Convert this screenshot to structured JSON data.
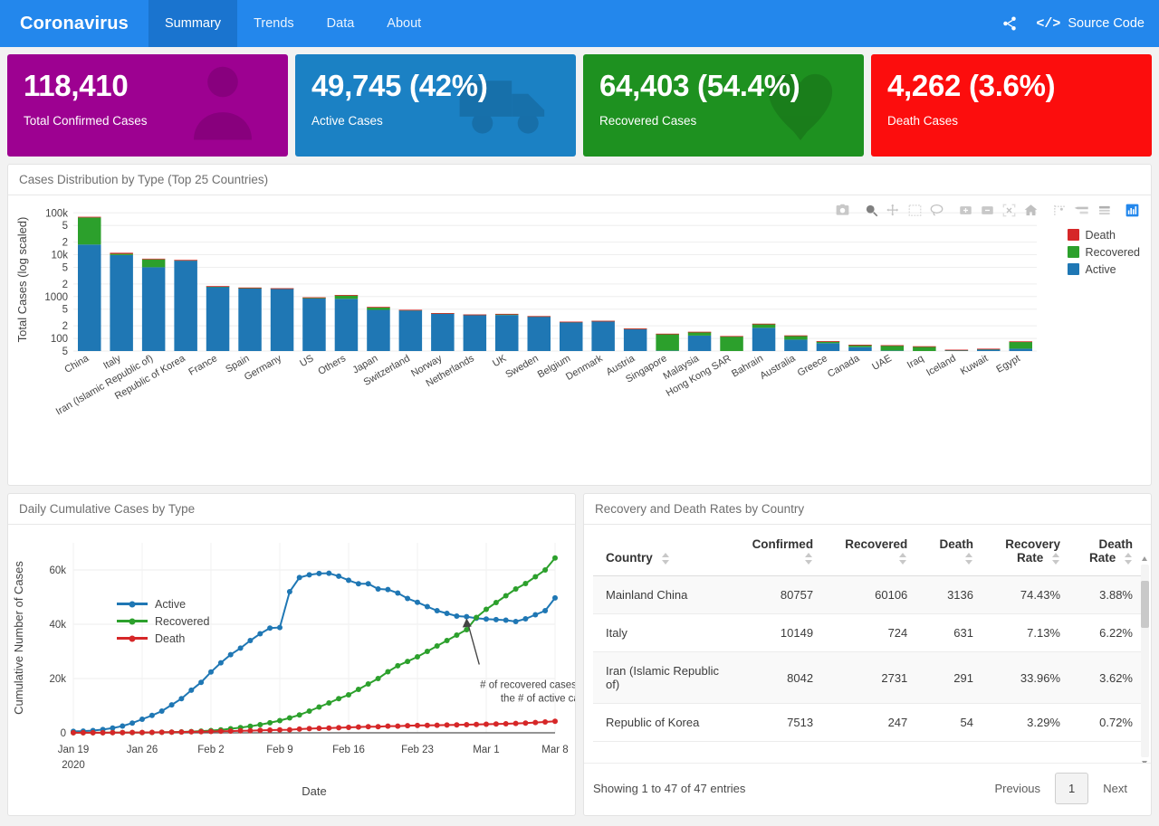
{
  "navbar": {
    "brand": "Coronavirus",
    "items": [
      {
        "label": "Summary",
        "active": true
      },
      {
        "label": "Trends",
        "active": false
      },
      {
        "label": "Data",
        "active": false
      },
      {
        "label": "About",
        "active": false
      }
    ],
    "share_icon": "share-icon",
    "source_code_label": "Source Code",
    "source_code_icon": "code-icon",
    "bg_color": "#2387ec",
    "active_bg_color": "#1a74cf"
  },
  "kpis": [
    {
      "value": "118,410",
      "label": "Total Confirmed Cases",
      "color": "#9d0191",
      "icon": "person-icon"
    },
    {
      "value": "49,745 (42%)",
      "label": "Active Cases",
      "color": "#1b81c4",
      "icon": "ambulance-icon"
    },
    {
      "value": "64,403 (54.4%)",
      "label": "Recovered Cases",
      "color": "#1e9120",
      "icon": "heart-arrow-down-icon"
    },
    {
      "value": "4,262 (3.6%)",
      "label": "Death Cases",
      "color": "#fc0d0d",
      "icon": "none"
    }
  ],
  "distribution_panel": {
    "title": "Cases Distribution by Type (Top 25 Countries)",
    "modebar": [
      {
        "name": "camera-icon",
        "title": "Download plot as a png"
      },
      {
        "name": "zoom-icon",
        "title": "Zoom"
      },
      {
        "name": "pan-icon",
        "title": "Pan"
      },
      {
        "name": "box-select-icon",
        "title": "Box Select"
      },
      {
        "name": "lasso-select-icon",
        "title": "Lasso Select"
      },
      {
        "name": "zoom-in-icon",
        "title": "Zoom in"
      },
      {
        "name": "zoom-out-icon",
        "title": "Zoom out"
      },
      {
        "name": "autoscale-icon",
        "title": "Autoscale"
      },
      {
        "name": "reset-axes-icon",
        "title": "Reset axes"
      },
      {
        "name": "spike-lines-icon",
        "title": "Toggle Spike Lines"
      },
      {
        "name": "hover-compare-icon",
        "title": "Show closest data on hover"
      },
      {
        "name": "hover-x-unified-icon",
        "title": "Compare data on hover"
      },
      {
        "name": "plotly-logo-icon",
        "title": "Produced with Plotly"
      }
    ]
  },
  "line_panel": {
    "title": "Daily Cumulative Cases by Type"
  },
  "table_panel": {
    "title": "Recovery and Death Rates by Country",
    "columns": [
      "Country",
      "Confirmed",
      "Recovered",
      "Death",
      "Recovery Rate",
      "Death Rate"
    ],
    "rows": [
      {
        "country": "Mainland China",
        "confirmed": "80757",
        "recovered": "60106",
        "death": "3136",
        "recovery_rate": "74.43%",
        "death_rate": "3.88%"
      },
      {
        "country": "Italy",
        "confirmed": "10149",
        "recovered": "724",
        "death": "631",
        "recovery_rate": "7.13%",
        "death_rate": "6.22%"
      },
      {
        "country": "Iran (Islamic Republic of)",
        "confirmed": "8042",
        "recovered": "2731",
        "death": "291",
        "recovery_rate": "33.96%",
        "death_rate": "3.62%"
      },
      {
        "country": "Republic of Korea",
        "confirmed": "7513",
        "recovered": "247",
        "death": "54",
        "recovery_rate": "3.29%",
        "death_rate": "0.72%"
      }
    ],
    "showing": "Showing 1 to 47 of 47 entries",
    "previous_label": "Previous",
    "page_number": "1",
    "next_label": "Next"
  },
  "colors": {
    "death": "#d62728",
    "recovered": "#2ca02c",
    "active": "#1f77b4",
    "brand": "#2387ec"
  },
  "chart_data": [
    {
      "type": "bar",
      "id": "cases-distribution-by-type",
      "title": "Cases Distribution by Type (Top 25 Countries)",
      "xlabel": "",
      "ylabel": "Total Cases (log scaled)",
      "yscale": "log",
      "ylim": [
        50,
        130000
      ],
      "ytick_labels": [
        "100k",
        "5",
        "2",
        "10k",
        "5",
        "2",
        "1000",
        "5",
        "2",
        "100",
        "5"
      ],
      "ytick_values": [
        100000,
        50000,
        20000,
        10000,
        5000,
        2000,
        1000,
        500,
        200,
        100,
        50
      ],
      "barmode": "stack",
      "grid": true,
      "legend_position": "right",
      "categories": [
        "China",
        "Italy",
        "Iran (Islamic Republic of)",
        "Republic of Korea",
        "France",
        "Spain",
        "Germany",
        "US",
        "Others",
        "Japan",
        "Switzerland",
        "Norway",
        "Netherlands",
        "UK",
        "Sweden",
        "Belgium",
        "Denmark",
        "Austria",
        "Singapore",
        "Malaysia",
        "Hong Kong SAR",
        "Bahrain",
        "Australia",
        "Greece",
        "Canada",
        "UAE",
        "Iraq",
        "Iceland",
        "Kuwait",
        "Egypt"
      ],
      "series": [
        {
          "name": "Active",
          "color": "#1f77b4",
          "values": [
            17515,
            9794,
            5020,
            7212,
            1733,
            1583,
            1558,
            926,
            884,
            481,
            466,
            400,
            371,
            362,
            340,
            250,
            262,
            168,
            51,
            117,
            44,
            180,
            94,
            77,
            62,
            51,
            43,
            52,
            55,
            57
          ]
        },
        {
          "name": "Recovered",
          "color": "#2ca02c",
          "values": [
            60106,
            724,
            2731,
            247,
            12,
            30,
            18,
            8,
            200,
            76,
            15,
            1,
            1,
            19,
            1,
            1,
            1,
            4,
            78,
            26,
            68,
            44,
            21,
            8,
            8,
            17,
            21,
            1,
            1,
            27
          ]
        },
        {
          "name": "Death",
          "color": "#d62728",
          "values": [
            3136,
            631,
            291,
            54,
            33,
            35,
            2,
            26,
            4,
            10,
            2,
            1,
            1,
            6,
            1,
            1,
            1,
            1,
            1,
            1,
            2,
            1,
            3,
            1,
            1,
            1,
            1,
            1,
            1,
            1
          ]
        }
      ]
    },
    {
      "type": "line",
      "id": "daily-cumulative-cases-by-type",
      "title": "Daily Cumulative Cases by Type",
      "xlabel": "Date",
      "ylabel": "Cumulative Number of Cases",
      "ylim": [
        0,
        70000
      ],
      "ytick_labels": [
        "0",
        "20k",
        "40k",
        "60k"
      ],
      "ytick_values": [
        0,
        20000,
        40000,
        60000
      ],
      "xtick_labels": [
        "Jan 19\n2020",
        "Jan 26",
        "Feb 2",
        "Feb 9",
        "Feb 16",
        "Feb 23",
        "Mar 1",
        "Mar 8"
      ],
      "grid": true,
      "legend_position": "upper-left",
      "annotation": "# of recovered cases surpass\nthe # of active cases",
      "x": [
        "Jan 21",
        "Jan 22",
        "Jan 23",
        "Jan 24",
        "Jan 25",
        "Jan 26",
        "Jan 27",
        "Jan 28",
        "Jan 29",
        "Jan 30",
        "Jan 31",
        "Feb 1",
        "Feb 2",
        "Feb 3",
        "Feb 4",
        "Feb 5",
        "Feb 6",
        "Feb 7",
        "Feb 8",
        "Feb 9",
        "Feb 10",
        "Feb 11",
        "Feb 12",
        "Feb 13",
        "Feb 14",
        "Feb 15",
        "Feb 16",
        "Feb 17",
        "Feb 18",
        "Feb 19",
        "Feb 20",
        "Feb 21",
        "Feb 22",
        "Feb 23",
        "Feb 24",
        "Feb 25",
        "Feb 26",
        "Feb 27",
        "Feb 28",
        "Feb 29",
        "Mar 1",
        "Mar 2",
        "Mar 3",
        "Mar 4",
        "Mar 5",
        "Mar 6",
        "Mar 7",
        "Mar 8",
        "Mar 9",
        "Mar 10"
      ],
      "series": [
        {
          "name": "Active",
          "color": "#1f77b4",
          "values": [
            535,
            620,
            820,
            1200,
            1750,
            2500,
            3600,
            5000,
            6400,
            8000,
            10300,
            12600,
            15700,
            18600,
            22400,
            25800,
            28800,
            31200,
            34000,
            36500,
            38600,
            38800,
            52000,
            57200,
            58200,
            58700,
            58800,
            57700,
            56200,
            54900,
            54900,
            53000,
            52800,
            51500,
            49500,
            48100,
            46500,
            45000,
            44000,
            43000,
            42800,
            42200,
            41900,
            41700,
            41500,
            41000,
            42000,
            43500,
            45000,
            49700
          ]
        },
        {
          "name": "Recovered",
          "color": "#2ca02c",
          "values": [
            30,
            32,
            36,
            42,
            52,
            63,
            80,
            110,
            140,
            190,
            250,
            320,
            480,
            630,
            840,
            1100,
            1500,
            1900,
            2400,
            3000,
            3700,
            4500,
            5500,
            6600,
            8000,
            9500,
            11000,
            12600,
            14000,
            16000,
            18000,
            20000,
            22500,
            24700,
            26300,
            28000,
            30000,
            32000,
            34000,
            36000,
            38000,
            42500,
            45500,
            48000,
            50500,
            53000,
            55000,
            57500,
            60000,
            64400
          ]
        },
        {
          "name": "Death",
          "color": "#d62728",
          "values": [
            17,
            18,
            26,
            42,
            56,
            82,
            131,
            133,
            171,
            213,
            259,
            304,
            362,
            426,
            492,
            564,
            634,
            719,
            806,
            906,
            1013,
            1113,
            1118,
            1371,
            1523,
            1666,
            1770,
            1868,
            2007,
            2122,
            2247,
            2251,
            2458,
            2469,
            2629,
            2708,
            2770,
            2814,
            2872,
            2941,
            2996,
            3085,
            3160,
            3254,
            3348,
            3460,
            3558,
            3802,
            4012,
            4262
          ]
        }
      ]
    }
  ]
}
